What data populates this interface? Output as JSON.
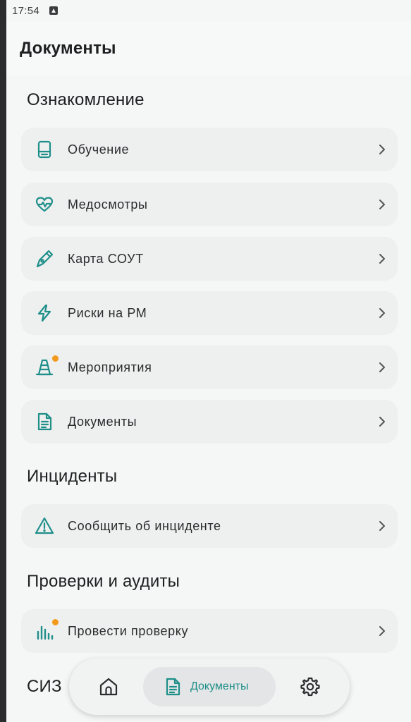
{
  "status_bar": {
    "time": "17:54"
  },
  "app_bar": {
    "title": "Документы"
  },
  "sections": [
    {
      "title": "Ознакомление",
      "items": [
        {
          "label": "Обучение",
          "icon": "book-icon",
          "badge": false
        },
        {
          "label": "Медосмотры",
          "icon": "heart-pulse-icon",
          "badge": false
        },
        {
          "label": "Карта СОУТ",
          "icon": "pen-tool-icon",
          "badge": false
        },
        {
          "label": "Риски на РМ",
          "icon": "lightning-icon",
          "badge": false
        },
        {
          "label": "Мероприятия",
          "icon": "traffic-cone-icon",
          "badge": true
        },
        {
          "label": "Документы",
          "icon": "document-icon",
          "badge": false
        }
      ]
    },
    {
      "title": "Инциденты",
      "items": [
        {
          "label": "Сообщить об инциденте",
          "icon": "warning-triangle-icon",
          "badge": false
        }
      ]
    },
    {
      "title": "Проверки и аудиты",
      "items": [
        {
          "label": "Провести проверку",
          "icon": "bar-chart-icon",
          "badge": true
        }
      ]
    },
    {
      "title": "СИЗ",
      "items": []
    }
  ],
  "bottom_nav": {
    "home_icon": "home-icon",
    "active_label": "Документы",
    "active_icon": "document-icon",
    "settings_icon": "gear-icon"
  },
  "colors": {
    "accent": "#1f8f8a",
    "badge": "#f39a1d",
    "card": "#eeefef",
    "background": "#f5f6f6"
  }
}
